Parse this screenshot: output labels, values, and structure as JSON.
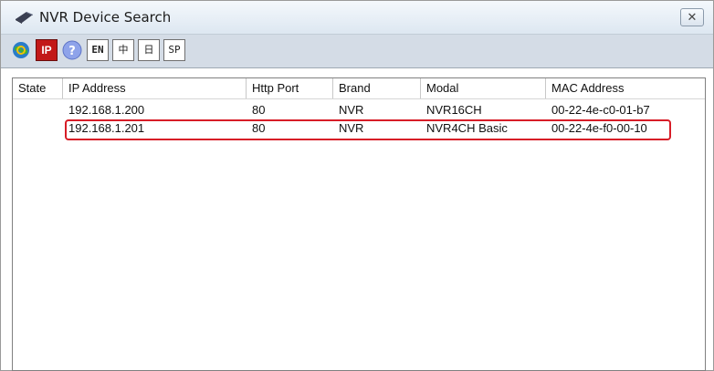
{
  "window": {
    "title": "NVR Device Search",
    "close_symbol": "✕"
  },
  "toolbar": {
    "buttons": [
      {
        "icon": "search-globe-icon"
      },
      {
        "icon": "ip-icon",
        "label": "IP"
      },
      {
        "icon": "help-icon"
      },
      {
        "icon": "english-icon",
        "label": "EN"
      },
      {
        "icon": "chinese-icon",
        "label": "中"
      },
      {
        "icon": "japanese-icon",
        "label": "日"
      },
      {
        "icon": "spanish-icon",
        "label": "SP"
      }
    ]
  },
  "table": {
    "columns": [
      "State",
      "IP Address",
      "Http Port",
      "Brand",
      "Modal",
      "MAC Address"
    ],
    "rows": [
      {
        "state": "",
        "ip": "192.168.1.200",
        "port": "80",
        "brand": "NVR",
        "modal": "NVR16CH",
        "mac": "00-22-4e-c0-01-b7"
      },
      {
        "state": "",
        "ip": "192.168.1.201",
        "port": "80",
        "brand": "NVR",
        "modal": "NVR4CH Basic",
        "mac": "00-22-4e-f0-00-10"
      }
    ]
  },
  "colors": {
    "highlight_border": "#d71d27",
    "toolbar_bg": "#d4dce6"
  }
}
